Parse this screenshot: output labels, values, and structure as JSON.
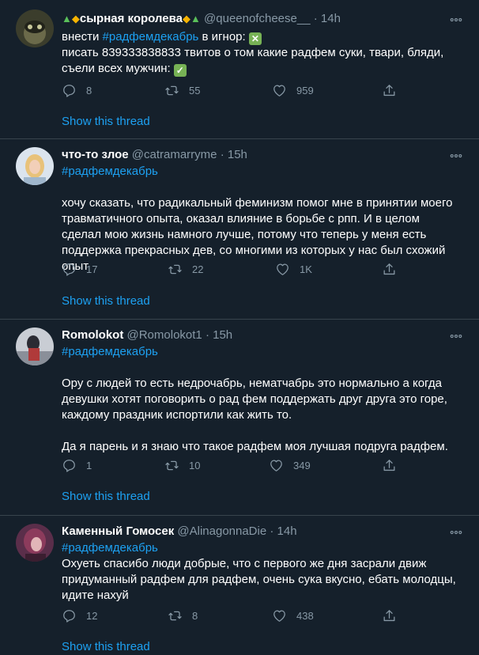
{
  "tweets": [
    {
      "name": "сырная королева",
      "handle": "@queenofcheese__",
      "time": "· 14h",
      "hashtag": "",
      "text_before": "внести ",
      "inline_hashtag": "#радфемдекабрь",
      "text_after": " в игнор: ",
      "line2": "писать 839333838833 твитов о том какие радфем суки, твари, бляди,",
      "line3": "съели всех мужчин: ",
      "replies": "8",
      "retweets": "55",
      "likes": "959",
      "show_thread": "Show this thread"
    },
    {
      "name": "что-то злое",
      "handle": "@catramarryme",
      "time": "· 15h",
      "hashtag": "#радфемдекабрь",
      "paragraph": "хочу сказать, что радикальный феминизм помог мне в принятии моего травматичного опыта, оказал влияние в борьбе с рпп. И в целом сделал мою жизнь намного лучше, потому что теперь у меня есть поддержка прекрасных дев, со многими из которых у нас был схожий опыт",
      "replies": "17",
      "retweets": "22",
      "likes": "1K",
      "show_thread": "Show this thread"
    },
    {
      "name": "Romolokot",
      "handle": "@Romolokot1",
      "time": "· 15h",
      "hashtag": "#радфемдекабрь",
      "paragraph": "Ору с людей то есть недрочабрь, нематчабрь это нормально а когда девушки хотят поговорить о рад фем поддержать друг друга это горе, каждому праздник испортили как жить то.",
      "paragraph2": "Да я парень и я знаю что такое радфем моя лучшая подруга радфем.",
      "replies": "1",
      "retweets": "10",
      "likes": "349",
      "show_thread": "Show this thread"
    },
    {
      "name": "Каменный Гомосек",
      "handle": "@AlinagonnaDie",
      "time": "· 14h",
      "hashtag": "#радфемдекабрь",
      "paragraph": "Охуеть спасибо люди добрые, что с первого же дня засрали движ придуманный радфем для радфем, очень сука вкусно, ебать молодцы, идите нахуй",
      "replies": "12",
      "retweets": "8",
      "likes": "438",
      "show_thread": "Show this thread"
    }
  ],
  "colors": {
    "background": "#15202b",
    "link": "#1da1f2",
    "muted": "#8899a6",
    "divider": "#38444d"
  }
}
